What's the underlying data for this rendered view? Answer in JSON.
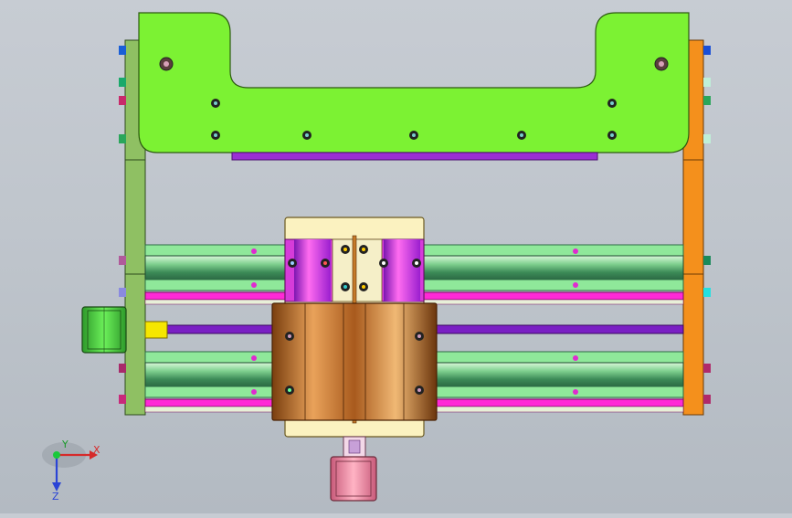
{
  "viewport": {
    "colors": {
      "background": "#c3c8cf",
      "top_plate": "#7cf233",
      "right_frame": "#f4901c",
      "left_frame": "#8fc063",
      "rail": "#8fe89a",
      "rail_tube": "#4aa36a",
      "magenta_bar": "#ff29d6",
      "purple_rod": "#7a1fc4",
      "carriage_plate": "#fbf2c0",
      "bronze_block": "#c47a2a",
      "motor_left": "#4dd63a",
      "motor_bottom": "#f28aa0",
      "coupler": "#f6e600"
    },
    "triad": {
      "x_label": "X",
      "y_label": "Y",
      "z_label": "Z"
    }
  }
}
